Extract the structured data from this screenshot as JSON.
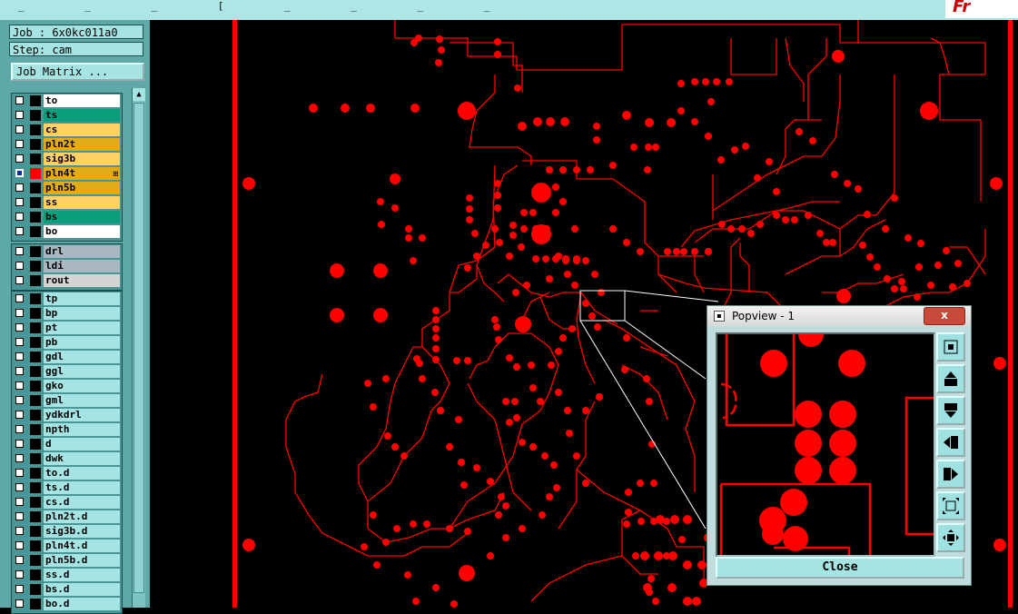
{
  "titlebar": {
    "controls_text": "_ _ _ [ _ _ _ _",
    "brand_text": "Fr"
  },
  "panel": {
    "job_line": "Job : 6x0kc011a0",
    "step_line": "Step: cam",
    "job_matrix_label": "Job Matrix ..."
  },
  "layers": {
    "board": [
      {
        "name": "to",
        "color": "#ffffff"
      },
      {
        "name": "ts",
        "color": "#0a9e7c"
      },
      {
        "name": "cs",
        "color": "#ffd166"
      },
      {
        "name": "pln2t",
        "color": "#e0ac1a"
      },
      {
        "name": "sig3b",
        "color": "#ffd166"
      },
      {
        "name": "pln4t",
        "color": "#e0ac1a"
      },
      {
        "name": "pln5b",
        "color": "#e0ac1a"
      },
      {
        "name": "ss",
        "color": "#ffd166"
      },
      {
        "name": "bs",
        "color": "#0a9e7c"
      },
      {
        "name": "bo",
        "color": "#ffffff"
      }
    ],
    "drill": [
      {
        "name": "drl",
        "color": "#a9b8c0"
      },
      {
        "name": "ldi",
        "color": "#a9b8c0"
      },
      {
        "name": "rout",
        "color": "#d4d4d4"
      }
    ],
    "misc": [
      {
        "name": "tp"
      },
      {
        "name": "bp"
      },
      {
        "name": "pt"
      },
      {
        "name": "pb"
      },
      {
        "name": "gdl"
      },
      {
        "name": "ggl"
      },
      {
        "name": "gko"
      },
      {
        "name": "gml"
      },
      {
        "name": "ydkdrl"
      },
      {
        "name": "npth"
      },
      {
        "name": "d"
      },
      {
        "name": "dwk"
      },
      {
        "name": "to.d"
      },
      {
        "name": "ts.d"
      },
      {
        "name": "cs.d"
      },
      {
        "name": "pln2t.d"
      },
      {
        "name": "sig3b.d"
      },
      {
        "name": "pln4t.d"
      },
      {
        "name": "pln5b.d"
      },
      {
        "name": "ss.d"
      },
      {
        "name": "bs.d"
      },
      {
        "name": "bo.d"
      }
    ],
    "selected": "pln4t",
    "misc_color": "#a6e4e4"
  },
  "colors": {
    "trace": "#ff0000",
    "canvas_bg": "#000000"
  },
  "popview": {
    "title": "Popview - 1",
    "close_x": "x",
    "close_button": "Close",
    "tools": [
      {
        "icon": "zoom-fit-icon"
      },
      {
        "icon": "pan-up-icon"
      },
      {
        "icon": "pan-down-icon"
      },
      {
        "icon": "pan-left-icon"
      },
      {
        "icon": "pan-right-icon"
      },
      {
        "icon": "zoom-out-icon"
      },
      {
        "icon": "zoom-in-icon"
      }
    ]
  },
  "scroll_arrow": "▲"
}
